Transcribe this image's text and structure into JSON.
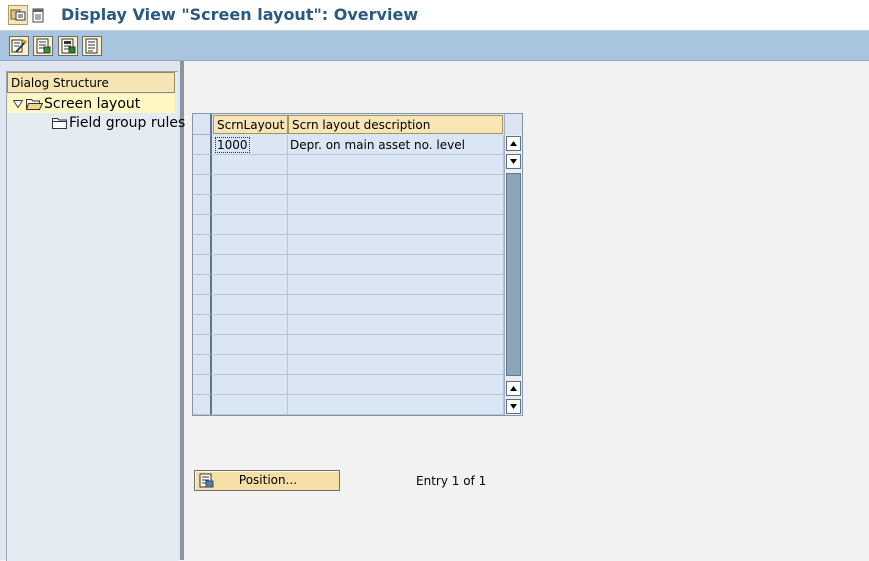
{
  "window": {
    "title": "Display View \"Screen layout\": Overview"
  },
  "toolbar": {
    "buttons": [
      "display-change-icon",
      "details-icon",
      "select-all-icon",
      "print-icon"
    ]
  },
  "dialog_structure": {
    "header": "Dialog Structure",
    "items": [
      {
        "label": "Screen layout",
        "icon": "folder-open-icon",
        "expanded": true,
        "selected": true
      },
      {
        "label": "Field group rules",
        "icon": "folder-icon",
        "expanded": false,
        "selected": false
      }
    ]
  },
  "table": {
    "columns": [
      "ScrnLayout",
      "Scrn layout description"
    ],
    "rows": [
      {
        "layout": "1000",
        "description": "Depr. on main asset no. level"
      }
    ],
    "visible_rows": 14
  },
  "position_button": {
    "label": "Position...",
    "icon": "position-icon"
  },
  "entry_status": "Entry 1 of 1",
  "colors": {
    "title": "#2a5a82",
    "toolbar": "#a9c4df",
    "header": "#f7e5b5",
    "cells": "#dbe6f4"
  }
}
